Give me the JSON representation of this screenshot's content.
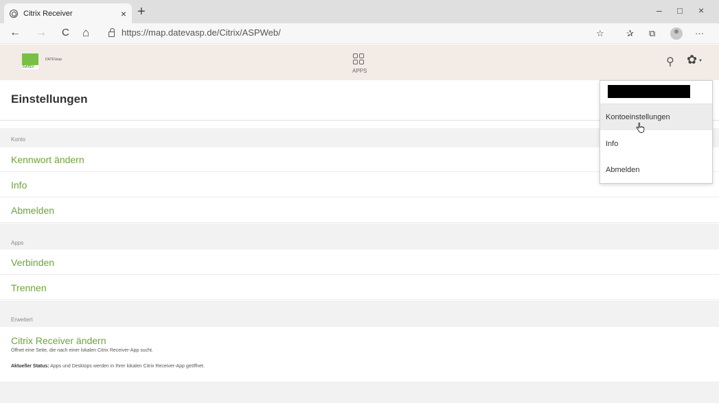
{
  "browser": {
    "tab_title": "Citrix Receiver",
    "tab_close": "×",
    "new_tab": "+",
    "url_host": "https://map.datevasp.de",
    "url_path": "/Citrix/ASPWeb/",
    "window_controls": {
      "minimize": "–",
      "maximize": "□",
      "close": "×"
    },
    "nav": {
      "back": "←",
      "forward": "→",
      "reload": "C",
      "home": "⌂"
    },
    "toolbar": {
      "read_aloud": "☆",
      "favorites": "✰",
      "collections": "⧉",
      "more": "···"
    }
  },
  "header": {
    "logo_name": "DATEVasp",
    "logo_sub": "DATEV",
    "apps_label": "APPS",
    "search_icon": "⚲",
    "settings_icon": "✿",
    "caret": "▼"
  },
  "page": {
    "title": "Einstellungen",
    "sections": [
      {
        "label": "Konto",
        "items": [
          "Kennwort ändern",
          "Info",
          "Abmelden"
        ]
      },
      {
        "label": "Apps",
        "items": [
          "Verbinden",
          "Trennen"
        ]
      },
      {
        "label": "Erweitert",
        "items": [
          "Citrix Receiver ändern"
        ]
      }
    ],
    "receiver_desc": "Öffnet eine Seite, die nach einer lokalen Citrix Receiver-App sucht.",
    "status_label": "Aktueller Status:",
    "status_text": " Apps und Desktops werden in Ihrer lokalen Citrix Receiver-App geöffnet."
  },
  "dropdown": {
    "items": [
      "Kontoeinstellungen",
      "Info",
      "Abmelden"
    ]
  },
  "colors": {
    "link_green": "#6aa538",
    "header_bg": "#f3ebe6",
    "logo_green": "#77c043"
  }
}
